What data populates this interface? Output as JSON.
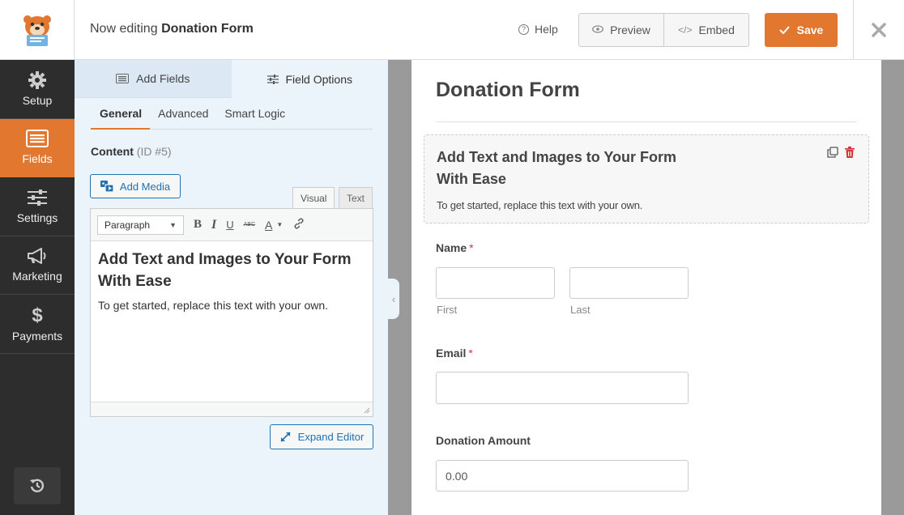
{
  "header": {
    "title_prefix": "Now editing",
    "form_name": "Donation Form",
    "help_label": "Help",
    "preview_label": "Preview",
    "embed_label": "Embed",
    "save_label": "Save"
  },
  "sidebar": {
    "items": [
      {
        "label": "Setup",
        "icon": "gear-icon"
      },
      {
        "label": "Fields",
        "icon": "fields-list-icon",
        "active": true
      },
      {
        "label": "Settings",
        "icon": "sliders-icon"
      },
      {
        "label": "Marketing",
        "icon": "megaphone-icon"
      },
      {
        "label": "Payments",
        "icon": "dollar-icon"
      }
    ],
    "revisions_icon": "history-icon"
  },
  "panel": {
    "tabs": [
      "Add Fields",
      "Field Options"
    ],
    "subtabs": [
      "General",
      "Advanced",
      "Smart Logic"
    ],
    "content_label": "Content",
    "content_id": "(ID #5)",
    "add_media_label": "Add Media",
    "editor_tabs": [
      "Visual",
      "Text"
    ],
    "format_select": "Paragraph",
    "toolbar": {
      "bold": "B",
      "italic": "I",
      "underline": "U",
      "strike": "ABC",
      "color": "A"
    },
    "editor_heading": "Add Text and Images to Your Form With Ease",
    "editor_body": "To get started, replace this text with your own.",
    "expand_label": "Expand Editor"
  },
  "preview": {
    "form_title": "Donation Form",
    "content_heading": "Add Text and Images to Your Form With Ease",
    "content_body": "To get started, replace this text with your own.",
    "name_label": "Name",
    "required_mark": "*",
    "first_label": "First",
    "last_label": "Last",
    "email_label": "Email",
    "amount_label": "Donation Amount",
    "amount_value": "0.00"
  },
  "colors": {
    "accent": "#e27730",
    "link": "#2271b1",
    "sidebar": "#2d2d2d",
    "required": "#d63638"
  }
}
